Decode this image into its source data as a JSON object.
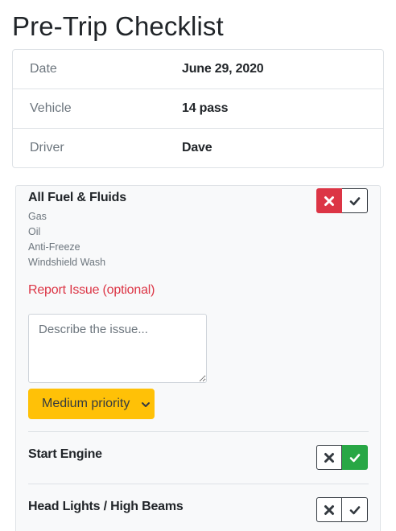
{
  "page": {
    "title": "Pre-Trip Checklist"
  },
  "info": {
    "rows": [
      {
        "label": "Date",
        "value": "June 29, 2020"
      },
      {
        "label": "Vehicle",
        "value": "14 pass"
      },
      {
        "label": "Driver",
        "value": "Dave"
      }
    ]
  },
  "checklist": {
    "items": [
      {
        "title": "All Fuel & Fluids",
        "status": "fail",
        "sub_items": [
          "Gas",
          "Oil",
          "Anti-Freeze",
          "Windshield Wash"
        ],
        "report_label": "Report Issue (optional)",
        "issue_placeholder": "Describe the issue...",
        "issue_value": "",
        "priority": "Medium priority"
      },
      {
        "title": "Start Engine",
        "status": "pass"
      },
      {
        "title": "Head Lights / High Beams",
        "status": "none"
      }
    ]
  },
  "colors": {
    "fail": "#dc3545",
    "pass": "#28a745",
    "warning": "#ffc107",
    "border": "#dee2e6",
    "muted": "#6c757d"
  },
  "icons": {
    "fail": "times-icon",
    "pass": "check-icon",
    "select": "chevron-down-icon"
  }
}
